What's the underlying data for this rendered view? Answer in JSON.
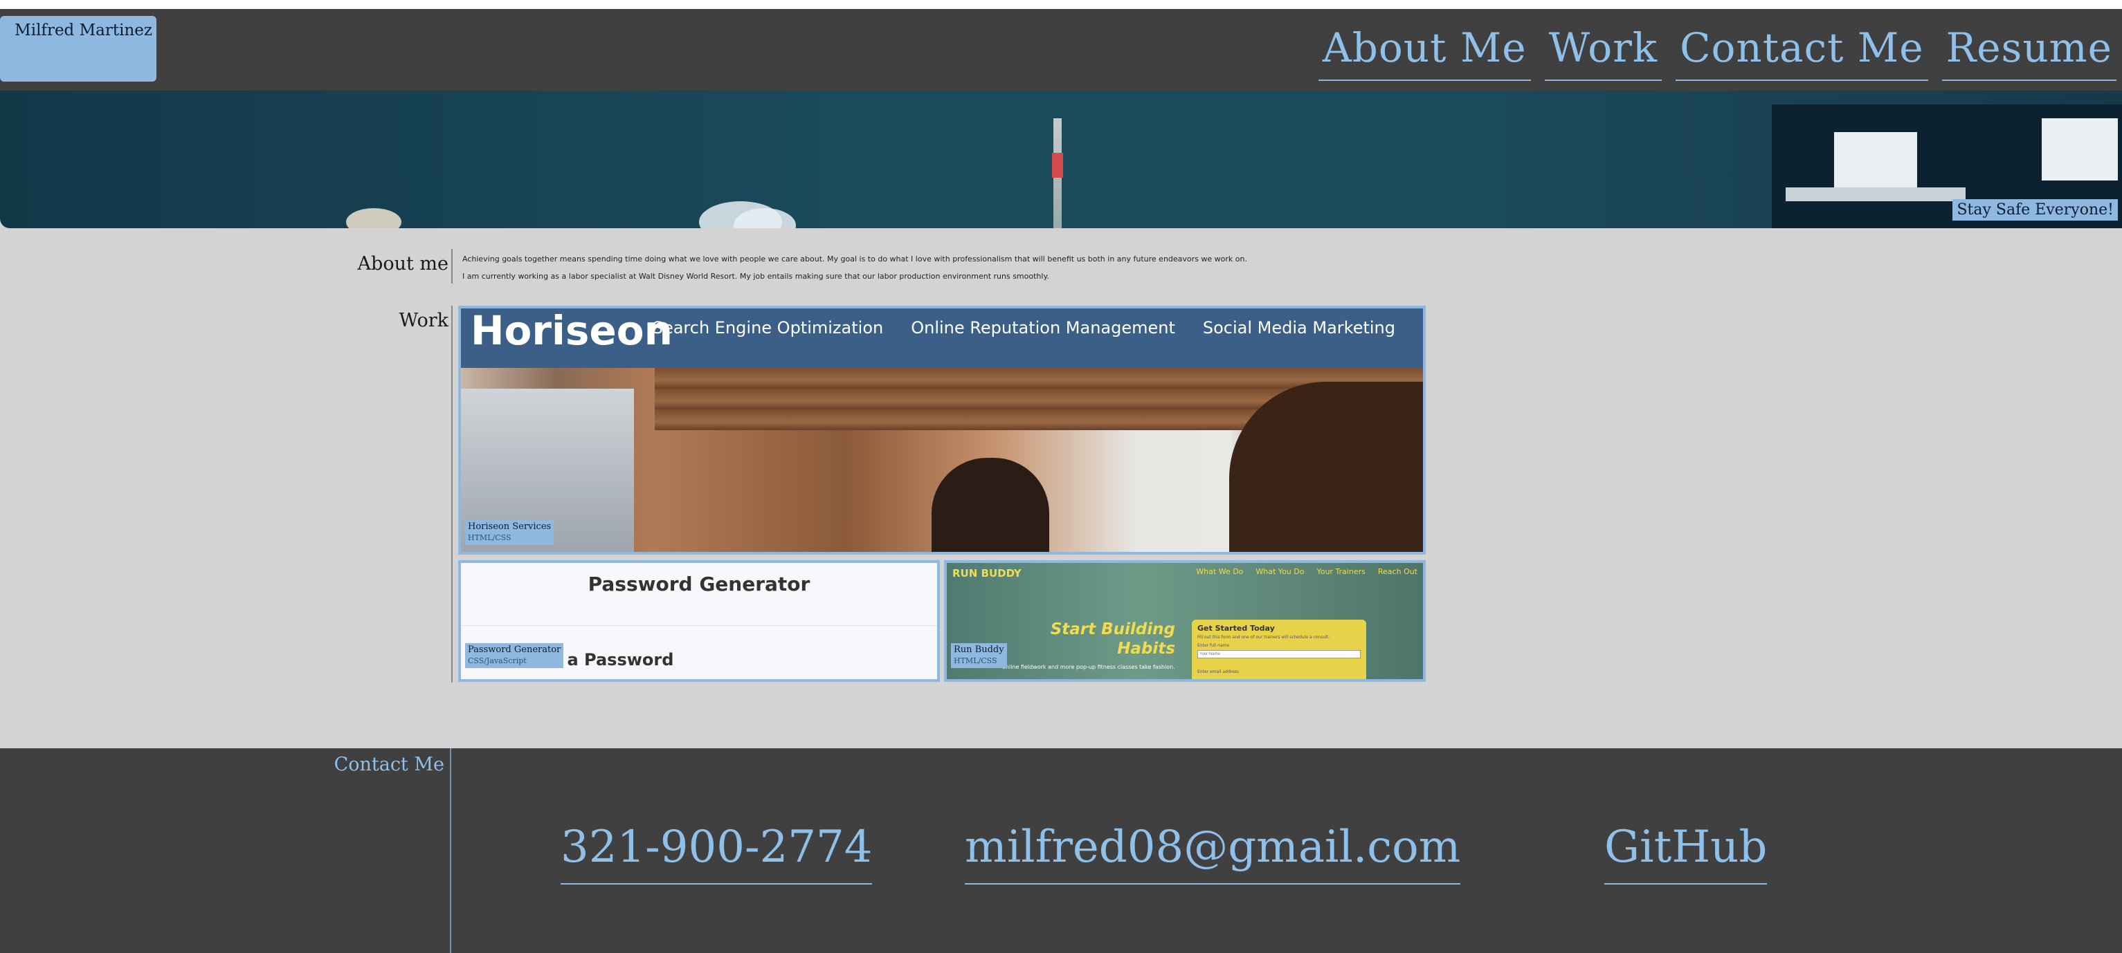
{
  "header": {
    "brand": "Milfred Martinez",
    "nav": [
      "About Me",
      "Work",
      "Contact Me",
      "Resume"
    ]
  },
  "hero": {
    "badge": "Stay Safe Everyone!"
  },
  "about": {
    "label": "About me",
    "lines": [
      "Achieving goals together means spending time doing what we love with people we care about.  My goal is to do what I love with professionalism that will benefit us both in any future endeavors we work on.",
      "I am currently working as a labor specialist at Walt Disney World Resort. My job entails making sure that our labor production environment runs smoothly."
    ]
  },
  "work": {
    "label": "Work",
    "projects": [
      {
        "name": "Horiseon Services",
        "tech": "HTML/CSS",
        "logo": "Horiseon",
        "nav": [
          "Search Engine Optimization",
          "Online Reputation Management",
          "Social Media Marketing"
        ]
      },
      {
        "name": "Password Generator",
        "tech": "CSS/JavaScript",
        "heading": "Password Generator",
        "subheading": "Generate a Password"
      },
      {
        "name": "Run Buddy",
        "tech": "HTML/CSS",
        "logo": "RUN BUDDY",
        "nav": [
          "What We Do",
          "What You Do",
          "Your Trainers",
          "Reach Out"
        ],
        "headline": "Start Building Habits",
        "form_title": "Get Started Today",
        "form_sub": "Fill out this form and one of our trainers will schedule a consult.",
        "field_label": "Enter full name",
        "field_placeholder": "Your Name",
        "field_label2": "Enter email address",
        "blurb": "online fieldwork and more pop-up fitness classes take fashion..."
      }
    ]
  },
  "contact": {
    "label": "Contact Me",
    "phone": "321-900-2774",
    "email": "milfred08@gmail.com",
    "github": "GitHub"
  },
  "colors": {
    "header_bg": "#404040",
    "accent": "#8fb8e0",
    "link": "#8fc0ea",
    "page_bg": "#d3d3d3"
  }
}
